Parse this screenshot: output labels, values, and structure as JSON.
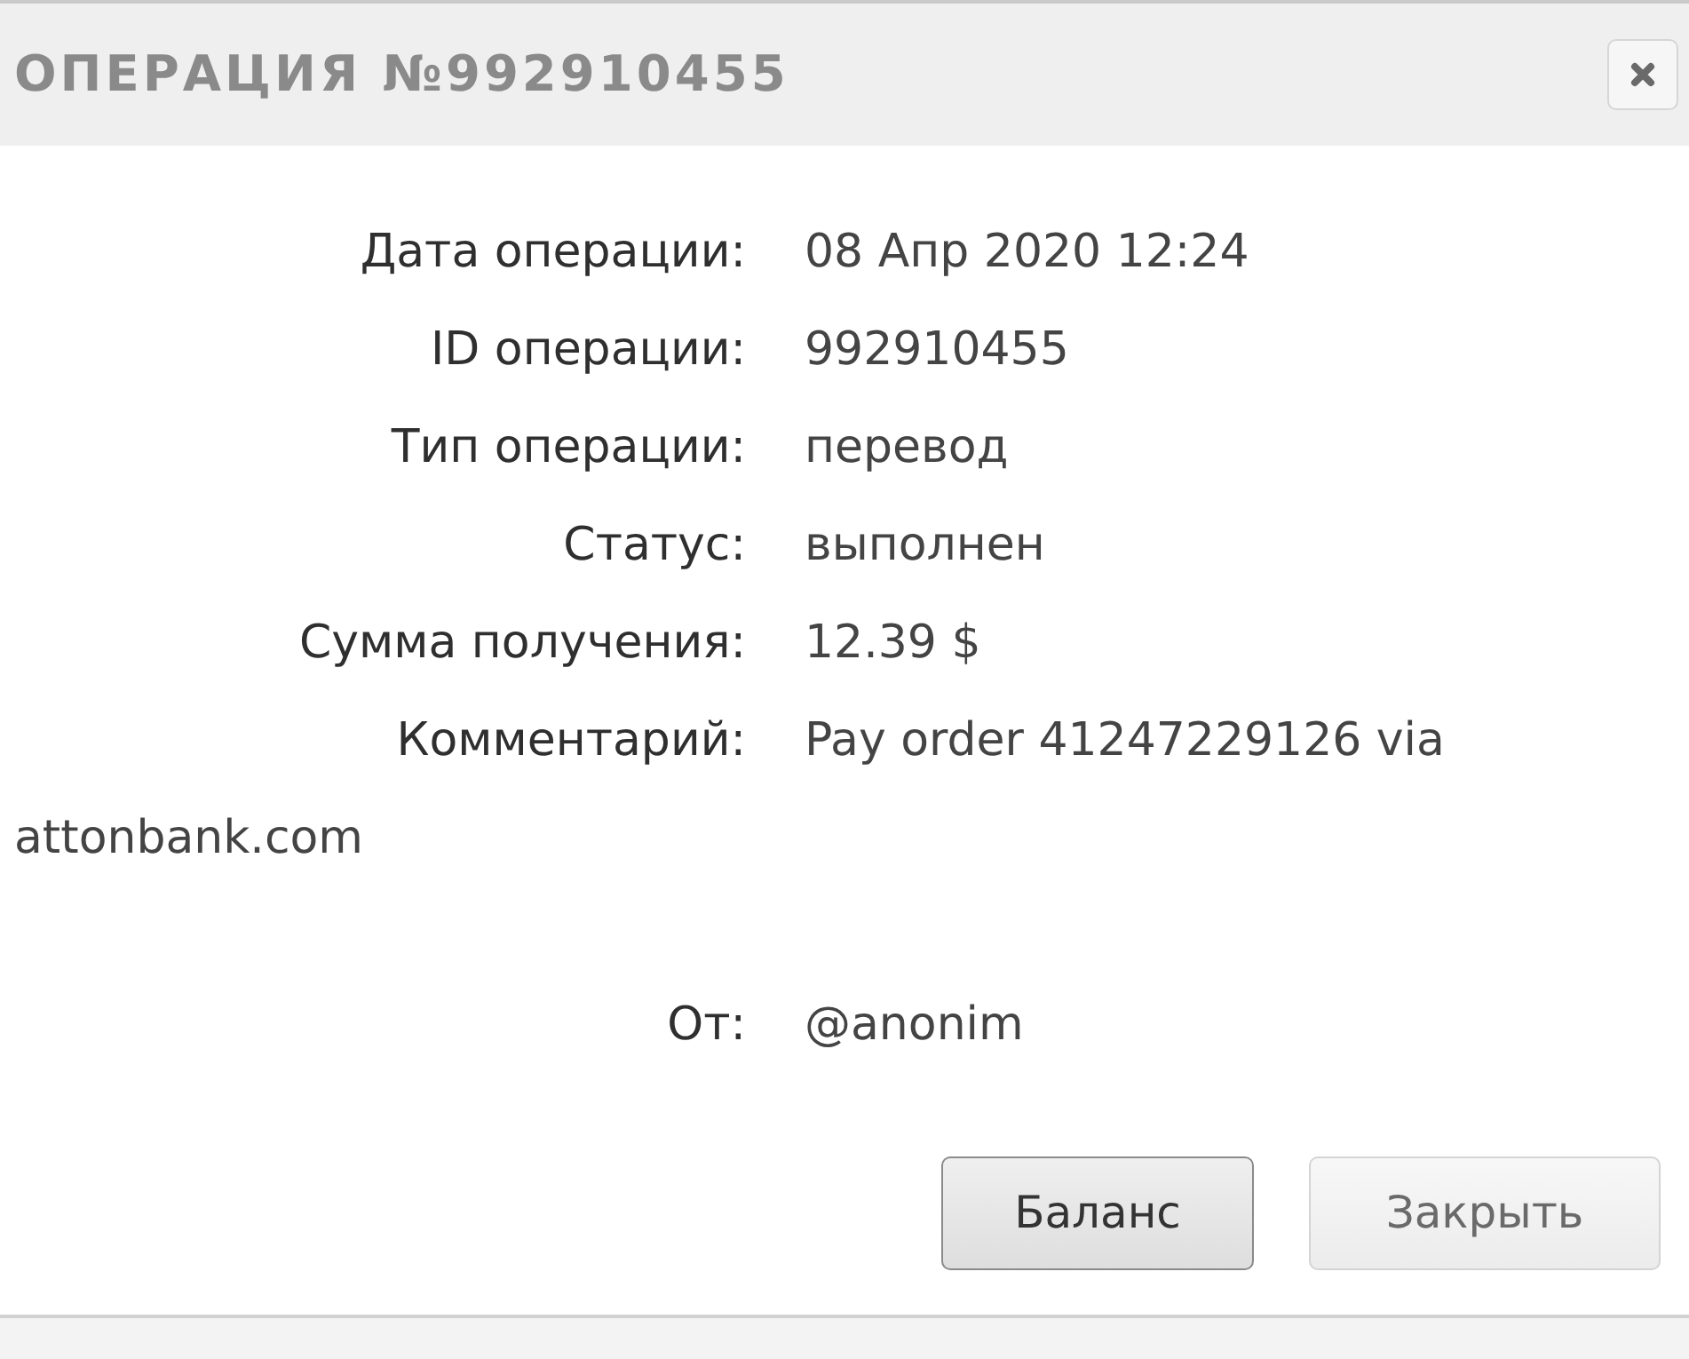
{
  "dialog": {
    "title": "ОПЕРАЦИЯ №992910455"
  },
  "fields": [
    {
      "label": "Дата операции:",
      "value": "08 Апр 2020 12:24"
    },
    {
      "label": "ID операции:",
      "value": "992910455"
    },
    {
      "label": "Тип операции:",
      "value": "перевод"
    },
    {
      "label": "Статус:",
      "value": "выполнен"
    },
    {
      "label": "Сумма получения:",
      "value": "12.39 $"
    },
    {
      "label": "Комментарий:",
      "value": "Pay order 41247229126 via",
      "value_continued": "attonbank.com"
    }
  ],
  "sender": {
    "label": "От:",
    "value": "@anonim"
  },
  "buttons": [
    {
      "label": "Баланс",
      "focused": true
    },
    {
      "label": "Закрыть",
      "focused": false
    }
  ]
}
